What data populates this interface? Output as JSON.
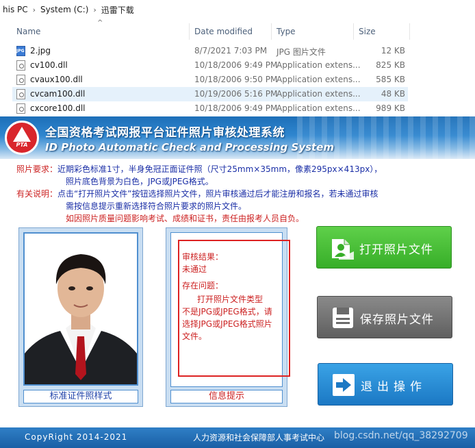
{
  "explorer": {
    "breadcrumb": [
      "his PC",
      "System (C:)",
      "迅雷下载"
    ],
    "columns": {
      "name": "Name",
      "date": "Date modified",
      "type": "Type",
      "size": "Size"
    },
    "files": [
      {
        "name": "2.jpg",
        "date": "8/7/2021 7:03 PM",
        "type": "JPG 图片文件",
        "size": "12 KB",
        "icon": "jpg-file-icon"
      },
      {
        "name": "cv100.dll",
        "date": "10/18/2006 9:49 PM",
        "type": "Application extens...",
        "size": "825 KB",
        "icon": "dll-file-icon"
      },
      {
        "name": "cvaux100.dll",
        "date": "10/18/2006 9:50 PM",
        "type": "Application extens...",
        "size": "585 KB",
        "icon": "dll-file-icon"
      },
      {
        "name": "cvcam100.dll",
        "date": "10/19/2006 5:16 PM",
        "type": "Application extens...",
        "size": "48 KB",
        "icon": "dll-file-icon"
      },
      {
        "name": "cxcore100.dll",
        "date": "10/18/2006 9:49 PM",
        "type": "Application extens...",
        "size": "989 KB",
        "icon": "dll-file-icon"
      }
    ]
  },
  "app": {
    "logo_text": "PTA",
    "title_cn": "全国资格考试网报平台证件照片审核处理系统",
    "title_en": "ID Photo Automatic Check and Processing System",
    "notice": {
      "req_label": "照片要求：",
      "req_line1": "近期彩色标准1寸，半身免冠正面证件照（尺寸25mm×35mm，像素295px×413px），",
      "req_line2": "照片底色背景为白色，JPG或JPEG格式。",
      "note_label": "有关说明：",
      "note_line1": "点击“打开照片文件”按钮选择照片文件，照片审核通过后才能注册和报名，若未通过审核",
      "note_line2": "需按信息提示重新选择符合照片要求的照片文件。",
      "note_line3": "如因照片质量问题影响考试、成绩和证书，责任由报考人员自负。"
    },
    "photo_caption": "标准证件照样式",
    "info_caption": "信息提示",
    "info": {
      "result_label": "审核结果：",
      "result_value": "未通过",
      "problem_label": "存在问题：",
      "problem_line1": "打开照片文件类型",
      "problem_line2": "不是JPG或JPEG格式，请",
      "problem_line3": "选择JPG或JPEG格式照片",
      "problem_line4": "文件。"
    },
    "buttons": {
      "open": "打开照片文件",
      "save": "保存照片文件",
      "exit": "退出操作"
    },
    "footer": {
      "copyright": "CopyRight 2014-2021",
      "org": "人力资源和社会保障部人事考试中心",
      "watermark": "blog.csdn.net/qq_38292709"
    }
  }
}
